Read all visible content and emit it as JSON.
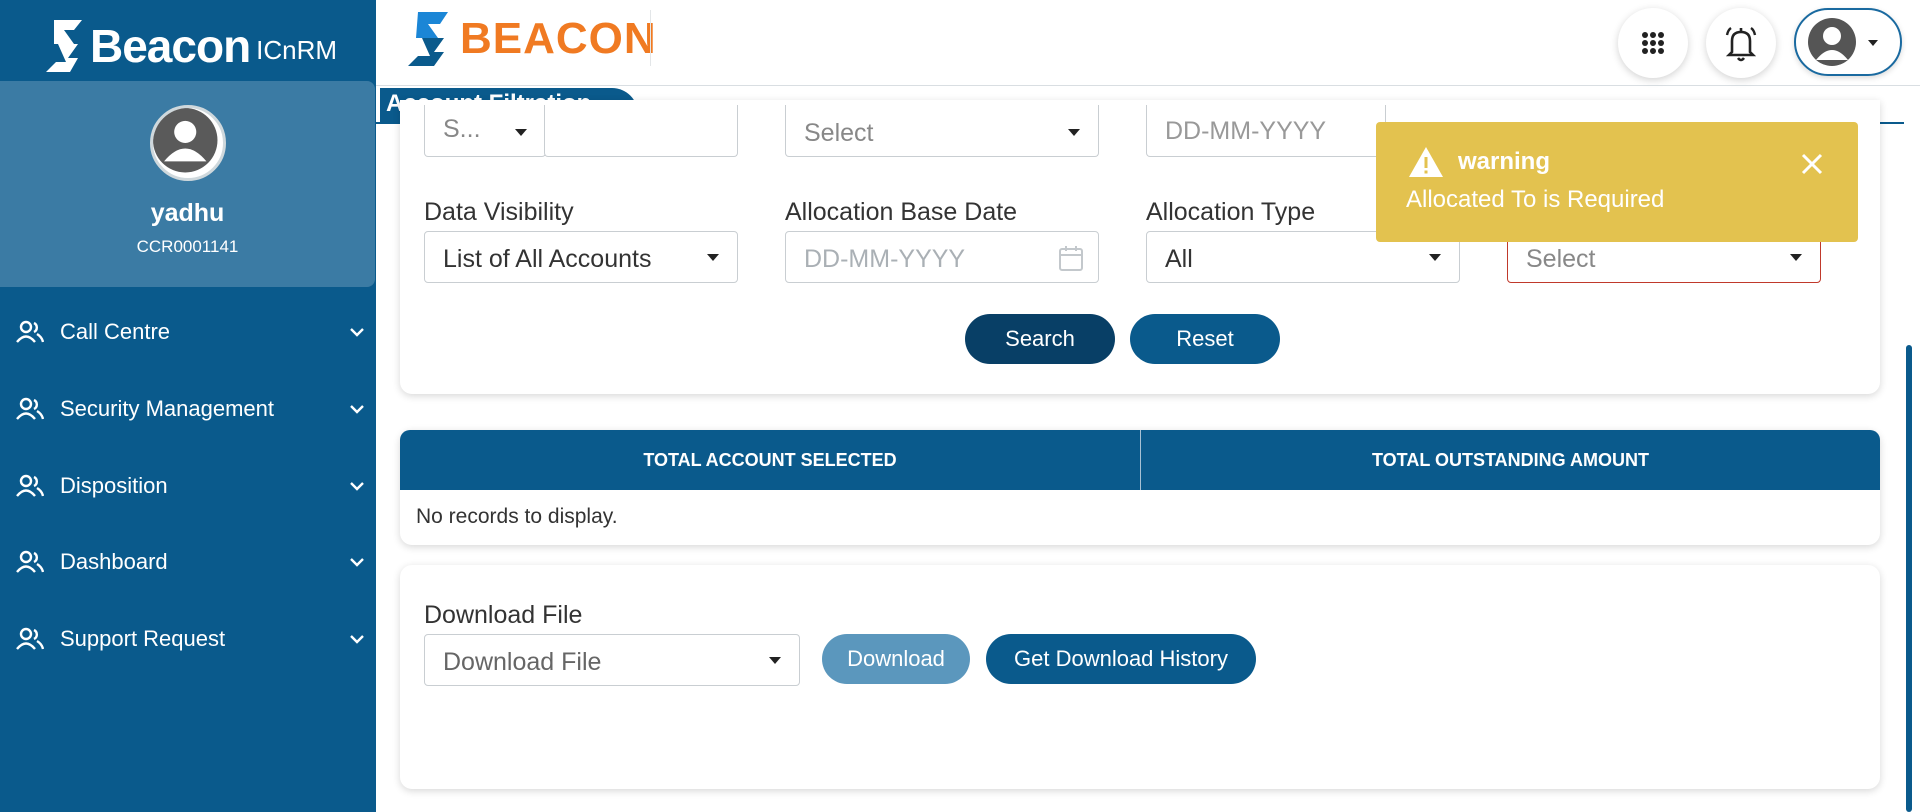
{
  "sidebar": {
    "brand": {
      "name": "Beacon",
      "sub": "ICnRM",
      "logo_icon": "beacon-s-logo-icon"
    },
    "profile": {
      "name": "yadhu",
      "code": "CCR0001141",
      "avatar_icon": "user-avatar-icon"
    },
    "items": [
      {
        "label": "Call Centre",
        "icon": "users-icon"
      },
      {
        "label": "Security Management",
        "icon": "users-icon"
      },
      {
        "label": "Disposition",
        "icon": "users-icon"
      },
      {
        "label": "Dashboard",
        "icon": "users-icon"
      },
      {
        "label": "Support Request",
        "icon": "users-icon"
      }
    ]
  },
  "topbar": {
    "logo_text": "BEACON",
    "apps_icon": "grid-icon",
    "bell_icon": "bell-icon",
    "user_icon": "user-avatar-icon"
  },
  "tab": {
    "label": "Account Filtration"
  },
  "filters": {
    "row1": {
      "small_select": "S...",
      "text_value": "",
      "select2": "Select",
      "date1_placeholder": "DD-MM-YYYY"
    },
    "data_visibility": {
      "label": "Data Visibility",
      "value": "List of All Accounts"
    },
    "allocation_base_date": {
      "label": "Allocation Base Date",
      "placeholder": "DD-MM-YYYY"
    },
    "allocation_type": {
      "label": "Allocation Type",
      "value": "All"
    },
    "allocated_to": {
      "value": "Select"
    },
    "search_label": "Search",
    "reset_label": "Reset"
  },
  "summary_table": {
    "columns": [
      "TOTAL ACCOUNT SELECTED",
      "TOTAL OUTSTANDING AMOUNT"
    ],
    "empty_text": "No records to display."
  },
  "download": {
    "label": "Download File",
    "select_placeholder": "Download File",
    "download_label": "Download",
    "history_label": "Get Download History"
  },
  "toast": {
    "title": "warning",
    "message": "Allocated To is Required"
  },
  "colors": {
    "primary": "#0a5a8c",
    "sidebar_profile": "#3b7ba4",
    "warning": "#e3c24f",
    "logo_orange": "#f07a22",
    "logo_blue": "#1b86d6"
  }
}
